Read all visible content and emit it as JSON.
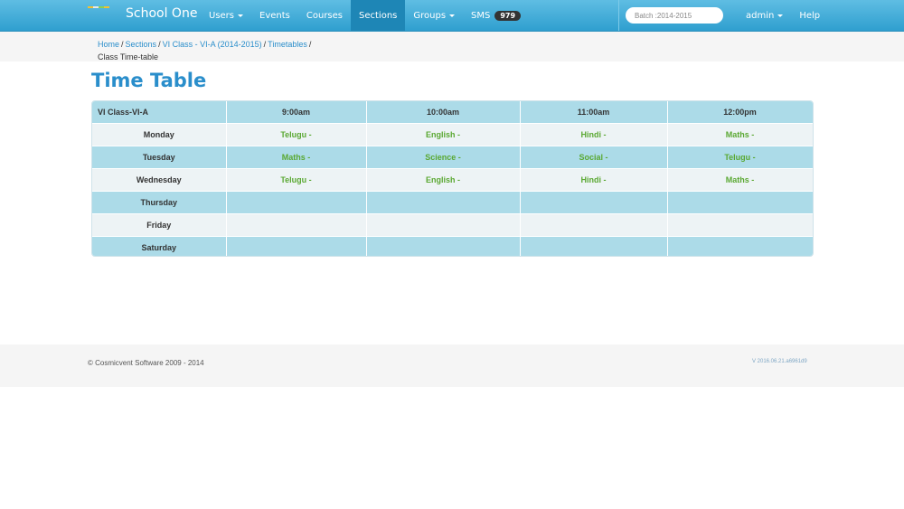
{
  "brand": {
    "name": "School One"
  },
  "nav": {
    "items": [
      {
        "label": "Users",
        "dropdown": true,
        "active": false
      },
      {
        "label": "Events",
        "dropdown": false,
        "active": false
      },
      {
        "label": "Courses",
        "dropdown": false,
        "active": false
      },
      {
        "label": "Sections",
        "dropdown": false,
        "active": true
      },
      {
        "label": "Groups",
        "dropdown": true,
        "active": false
      },
      {
        "label": "SMS",
        "dropdown": false,
        "active": false,
        "badge": "979"
      }
    ],
    "batch_placeholder": "Batch :2014-2015",
    "right": [
      {
        "label": "admin",
        "dropdown": true
      },
      {
        "label": "Help",
        "dropdown": false
      }
    ]
  },
  "breadcrumb": {
    "links": [
      "Home",
      "Sections",
      "VI Class - VI-A (2014-2015)",
      "Timetables"
    ],
    "current": "Class Time-table"
  },
  "title": "Time Table",
  "timetable": {
    "class_label": "VI Class-VI-A",
    "periods": [
      "9:00am",
      "10:00am",
      "11:00am",
      "12:00pm"
    ],
    "rows": [
      {
        "day": "Monday",
        "cells": [
          "Telugu -",
          "English -",
          "Hindi -",
          "Maths -"
        ]
      },
      {
        "day": "Tuesday",
        "cells": [
          "Maths -",
          "Science -",
          "Social -",
          "Telugu -"
        ]
      },
      {
        "day": "Wednesday",
        "cells": [
          "Telugu -",
          "English -",
          "Hindi -",
          "Maths -"
        ]
      },
      {
        "day": "Thursday",
        "cells": [
          "",
          "",
          "",
          ""
        ]
      },
      {
        "day": "Friday",
        "cells": [
          "",
          "",
          "",
          ""
        ]
      },
      {
        "day": "Saturday",
        "cells": [
          "",
          "",
          "",
          ""
        ]
      }
    ]
  },
  "footer": {
    "copyright": "© Cosmicvent Software 2009 - 2014",
    "version": "V 2016.06.21.a6961d9"
  },
  "colors": {
    "navbar": "#3aa8d8",
    "link": "#2a8ecb",
    "subject": "#5aa832",
    "row_alt": "#acdbe8"
  }
}
